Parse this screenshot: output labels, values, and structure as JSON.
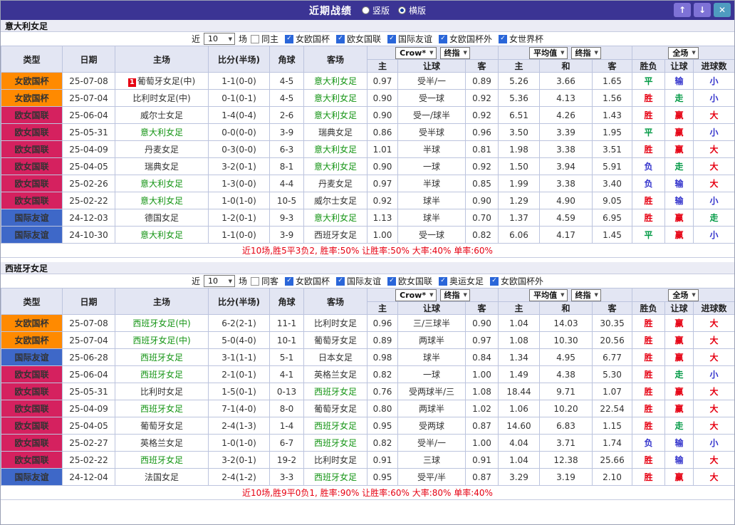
{
  "titlebar": {
    "title": "近期战绩",
    "radios": [
      {
        "label": "竖版",
        "checked": false
      },
      {
        "label": "横版",
        "checked": true
      }
    ],
    "buttons": {
      "up": "↑",
      "down": "↓",
      "close": "✕"
    }
  },
  "colors": {
    "type_badges": {
      "女欧国杯": "#ff8a00",
      "欧女国联": "#d5215f",
      "国际友谊": "#3e68c8"
    },
    "results": {
      "胜": "#e60012",
      "平": "#009944",
      "负": "#3333cc",
      "赢": "#e60012",
      "走": "#009944",
      "输": "#3333cc",
      "大": "#e60012",
      "小": "#3333cc"
    },
    "score_text": "#e8401f",
    "focus_team_text": "#149414",
    "summary_text": "#e60012",
    "titlebar_bg": "#3b3494"
  },
  "table_header": {
    "main_columns": [
      "类型",
      "日期",
      "主场",
      "比分(半场)",
      "角球",
      "客场"
    ],
    "groups": [
      {
        "selects": [
          "Crow*",
          "终指"
        ],
        "subs": [
          "主",
          "让球",
          "客"
        ]
      },
      {
        "selects": [
          "平均值",
          "终指"
        ],
        "subs": [
          "主",
          "和",
          "客"
        ]
      },
      {
        "selects": [
          "全场"
        ],
        "subs": [
          "胜负",
          "让球",
          "进球数"
        ]
      }
    ]
  },
  "sections": [
    {
      "team": "意大利女足",
      "filter": {
        "near_label": "近",
        "count": "10",
        "matches_label": "场",
        "checkboxes": [
          {
            "label": "同主",
            "checked": false
          },
          {
            "label": "女欧国杯",
            "checked": true
          },
          {
            "label": "欧女国联",
            "checked": true
          },
          {
            "label": "国际友谊",
            "checked": true
          },
          {
            "label": "女欧国杯外",
            "checked": true
          },
          {
            "label": "女世界杯",
            "checked": true
          }
        ]
      },
      "rows": [
        {
          "type": "女欧国杯",
          "date": "25-07-08",
          "home": "葡萄牙女足(中)",
          "home_mark": "1",
          "score": "1-1(0-0)",
          "corner": "4-5",
          "away": "意大利女足",
          "away_focus": true,
          "odds": [
            "0.97",
            "受半/一",
            "0.89"
          ],
          "avg": [
            "5.26",
            "3.66",
            "1.65"
          ],
          "results": [
            "平",
            "输",
            "小"
          ]
        },
        {
          "type": "女欧国杯",
          "date": "25-07-04",
          "home": "比利时女足(中)",
          "score": "0-1(0-1)",
          "corner": "4-5",
          "away": "意大利女足",
          "away_focus": true,
          "odds": [
            "0.90",
            "受一球",
            "0.92"
          ],
          "avg": [
            "5.36",
            "4.13",
            "1.56"
          ],
          "results": [
            "胜",
            "走",
            "小"
          ]
        },
        {
          "type": "欧女国联",
          "date": "25-06-04",
          "home": "威尔士女足",
          "score": "1-4(0-4)",
          "corner": "2-6",
          "away": "意大利女足",
          "away_focus": true,
          "odds": [
            "0.90",
            "受一/球半",
            "0.92"
          ],
          "avg": [
            "6.51",
            "4.26",
            "1.43"
          ],
          "results": [
            "胜",
            "赢",
            "大"
          ]
        },
        {
          "type": "欧女国联",
          "date": "25-05-31",
          "home": "意大利女足",
          "home_focus": true,
          "score": "0-0(0-0)",
          "corner": "3-9",
          "away": "瑞典女足",
          "odds": [
            "0.86",
            "受半球",
            "0.96"
          ],
          "avg": [
            "3.50",
            "3.39",
            "1.95"
          ],
          "results": [
            "平",
            "赢",
            "小"
          ]
        },
        {
          "type": "欧女国联",
          "date": "25-04-09",
          "home": "丹麦女足",
          "score": "0-3(0-0)",
          "corner": "6-3",
          "away": "意大利女足",
          "away_focus": true,
          "odds": [
            "1.01",
            "半球",
            "0.81"
          ],
          "avg": [
            "1.98",
            "3.38",
            "3.51"
          ],
          "results": [
            "胜",
            "赢",
            "大"
          ]
        },
        {
          "type": "欧女国联",
          "date": "25-04-05",
          "home": "瑞典女足",
          "score": "3-2(0-1)",
          "corner": "8-1",
          "away": "意大利女足",
          "away_focus": true,
          "odds": [
            "0.90",
            "一球",
            "0.92"
          ],
          "avg": [
            "1.50",
            "3.94",
            "5.91"
          ],
          "results": [
            "负",
            "走",
            "大"
          ]
        },
        {
          "type": "欧女国联",
          "date": "25-02-26",
          "home": "意大利女足",
          "home_focus": true,
          "score": "1-3(0-0)",
          "corner": "4-4",
          "away": "丹麦女足",
          "odds": [
            "0.97",
            "半球",
            "0.85"
          ],
          "avg": [
            "1.99",
            "3.38",
            "3.40"
          ],
          "results": [
            "负",
            "输",
            "大"
          ]
        },
        {
          "type": "欧女国联",
          "date": "25-02-22",
          "home": "意大利女足",
          "home_focus": true,
          "score": "1-0(1-0)",
          "corner": "10-5",
          "away": "威尔士女足",
          "odds": [
            "0.92",
            "球半",
            "0.90"
          ],
          "avg": [
            "1.29",
            "4.90",
            "9.05"
          ],
          "results": [
            "胜",
            "输",
            "小"
          ]
        },
        {
          "type": "国际友谊",
          "date": "24-12-03",
          "home": "德国女足",
          "score": "1-2(0-1)",
          "corner": "9-3",
          "away": "意大利女足",
          "away_focus": true,
          "odds": [
            "1.13",
            "球半",
            "0.70"
          ],
          "avg": [
            "1.37",
            "4.59",
            "6.95"
          ],
          "results": [
            "胜",
            "赢",
            "走"
          ]
        },
        {
          "type": "国际友谊",
          "date": "24-10-30",
          "home": "意大利女足",
          "home_focus": true,
          "score": "1-1(0-0)",
          "corner": "3-9",
          "away": "西班牙女足",
          "odds": [
            "1.00",
            "受一球",
            "0.82"
          ],
          "avg": [
            "6.06",
            "4.17",
            "1.45"
          ],
          "results": [
            "平",
            "赢",
            "小"
          ]
        }
      ],
      "summary": "近10场,胜5平3负2, 胜率:50% 让胜率:50% 大率:40% 单率:60%"
    },
    {
      "team": "西班牙女足",
      "filter": {
        "near_label": "近",
        "count": "10",
        "matches_label": "场",
        "checkboxes": [
          {
            "label": "同客",
            "checked": false
          },
          {
            "label": "女欧国杯",
            "checked": true
          },
          {
            "label": "国际友谊",
            "checked": true
          },
          {
            "label": "欧女国联",
            "checked": true
          },
          {
            "label": "奥运女足",
            "checked": true
          },
          {
            "label": "女欧国杯外",
            "checked": true
          }
        ]
      },
      "rows": [
        {
          "type": "女欧国杯",
          "date": "25-07-08",
          "home": "西班牙女足(中)",
          "home_focus": true,
          "score": "6-2(2-1)",
          "corner": "11-1",
          "away": "比利时女足",
          "odds": [
            "0.96",
            "三/三球半",
            "0.90"
          ],
          "avg": [
            "1.04",
            "14.03",
            "30.35"
          ],
          "results": [
            "胜",
            "赢",
            "大"
          ]
        },
        {
          "type": "女欧国杯",
          "date": "25-07-04",
          "home": "西班牙女足(中)",
          "home_focus": true,
          "score": "5-0(4-0)",
          "corner": "10-1",
          "away": "葡萄牙女足",
          "odds": [
            "0.89",
            "两球半",
            "0.97"
          ],
          "avg": [
            "1.08",
            "10.30",
            "20.56"
          ],
          "results": [
            "胜",
            "赢",
            "大"
          ]
        },
        {
          "type": "国际友谊",
          "date": "25-06-28",
          "home": "西班牙女足",
          "home_focus": true,
          "score": "3-1(1-1)",
          "corner": "5-1",
          "away": "日本女足",
          "odds": [
            "0.98",
            "球半",
            "0.84"
          ],
          "avg": [
            "1.34",
            "4.95",
            "6.77"
          ],
          "results": [
            "胜",
            "赢",
            "大"
          ]
        },
        {
          "type": "欧女国联",
          "date": "25-06-04",
          "home": "西班牙女足",
          "home_focus": true,
          "score": "2-1(0-1)",
          "corner": "4-1",
          "away": "英格兰女足",
          "odds": [
            "0.82",
            "一球",
            "1.00"
          ],
          "avg": [
            "1.49",
            "4.38",
            "5.30"
          ],
          "results": [
            "胜",
            "走",
            "小"
          ]
        },
        {
          "type": "欧女国联",
          "date": "25-05-31",
          "home": "比利时女足",
          "score": "1-5(0-1)",
          "corner": "0-13",
          "away": "西班牙女足",
          "away_focus": true,
          "odds": [
            "0.76",
            "受两球半/三",
            "1.08"
          ],
          "avg": [
            "18.44",
            "9.71",
            "1.07"
          ],
          "results": [
            "胜",
            "赢",
            "大"
          ]
        },
        {
          "type": "欧女国联",
          "date": "25-04-09",
          "home": "西班牙女足",
          "home_focus": true,
          "score": "7-1(4-0)",
          "corner": "8-0",
          "away": "葡萄牙女足",
          "odds": [
            "0.80",
            "两球半",
            "1.02"
          ],
          "avg": [
            "1.06",
            "10.20",
            "22.54"
          ],
          "results": [
            "胜",
            "赢",
            "大"
          ]
        },
        {
          "type": "欧女国联",
          "date": "25-04-05",
          "home": "葡萄牙女足",
          "score": "2-4(1-3)",
          "corner": "1-4",
          "away": "西班牙女足",
          "away_focus": true,
          "odds": [
            "0.95",
            "受两球",
            "0.87"
          ],
          "avg": [
            "14.60",
            "6.83",
            "1.15"
          ],
          "results": [
            "胜",
            "走",
            "大"
          ]
        },
        {
          "type": "欧女国联",
          "date": "25-02-27",
          "home": "英格兰女足",
          "score": "1-0(1-0)",
          "corner": "6-7",
          "away": "西班牙女足",
          "away_focus": true,
          "odds": [
            "0.82",
            "受半/一",
            "1.00"
          ],
          "avg": [
            "4.04",
            "3.71",
            "1.74"
          ],
          "results": [
            "负",
            "输",
            "小"
          ]
        },
        {
          "type": "欧女国联",
          "date": "25-02-22",
          "home": "西班牙女足",
          "home_focus": true,
          "score": "3-2(0-1)",
          "corner": "19-2",
          "away": "比利时女足",
          "odds": [
            "0.91",
            "三球",
            "0.91"
          ],
          "avg": [
            "1.04",
            "12.38",
            "25.66"
          ],
          "results": [
            "胜",
            "输",
            "大"
          ]
        },
        {
          "type": "国际友谊",
          "date": "24-12-04",
          "home": "法国女足",
          "score": "2-4(1-2)",
          "corner": "3-3",
          "away": "西班牙女足",
          "away_focus": true,
          "odds": [
            "0.95",
            "受平/半",
            "0.87"
          ],
          "avg": [
            "3.29",
            "3.19",
            "2.10"
          ],
          "results": [
            "胜",
            "赢",
            "大"
          ]
        }
      ],
      "summary": "近10场,胜9平0负1, 胜率:90% 让胜率:60% 大率:80% 单率:40%"
    }
  ]
}
